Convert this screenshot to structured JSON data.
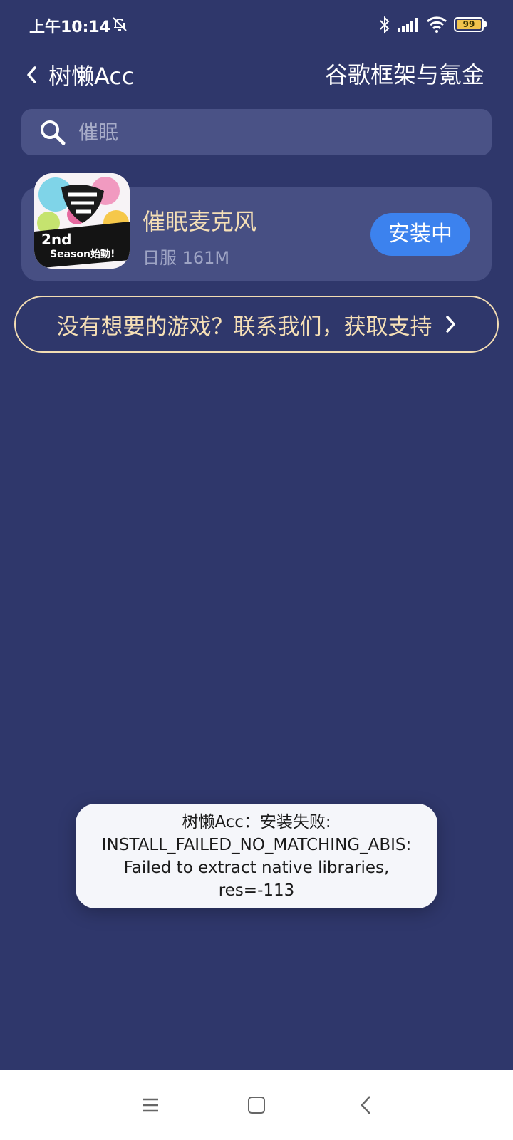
{
  "status_bar": {
    "time": "上午10:14",
    "battery_level": "99",
    "icons": [
      "bell-muted-icon",
      "bluetooth-icon",
      "signal-icon",
      "wifi-icon",
      "battery-icon"
    ]
  },
  "header": {
    "app_name": "树懒Acc",
    "right_title": "谷歌框架与氪金"
  },
  "search": {
    "value": "",
    "placeholder": "催眠"
  },
  "game": {
    "title": "催眠麦克风",
    "meta": "日服 161M",
    "button_label": "安装中",
    "icon_text_line1": "2nd",
    "icon_text_line2": "Season始動!"
  },
  "contact": {
    "label": "没有想要的游戏？联系我们，获取支持"
  },
  "toast": {
    "line1": "树懒Acc：安装失败:",
    "line2": "INSTALL_FAILED_NO_MATCHING_ABIS:",
    "line3": "Failed to extract native libraries,",
    "line4": "res=-113"
  },
  "colors": {
    "background": "#2f376b",
    "card": "#474f83",
    "accent_gold": "#f5dfb6",
    "install_blue": "#3c82ee"
  }
}
